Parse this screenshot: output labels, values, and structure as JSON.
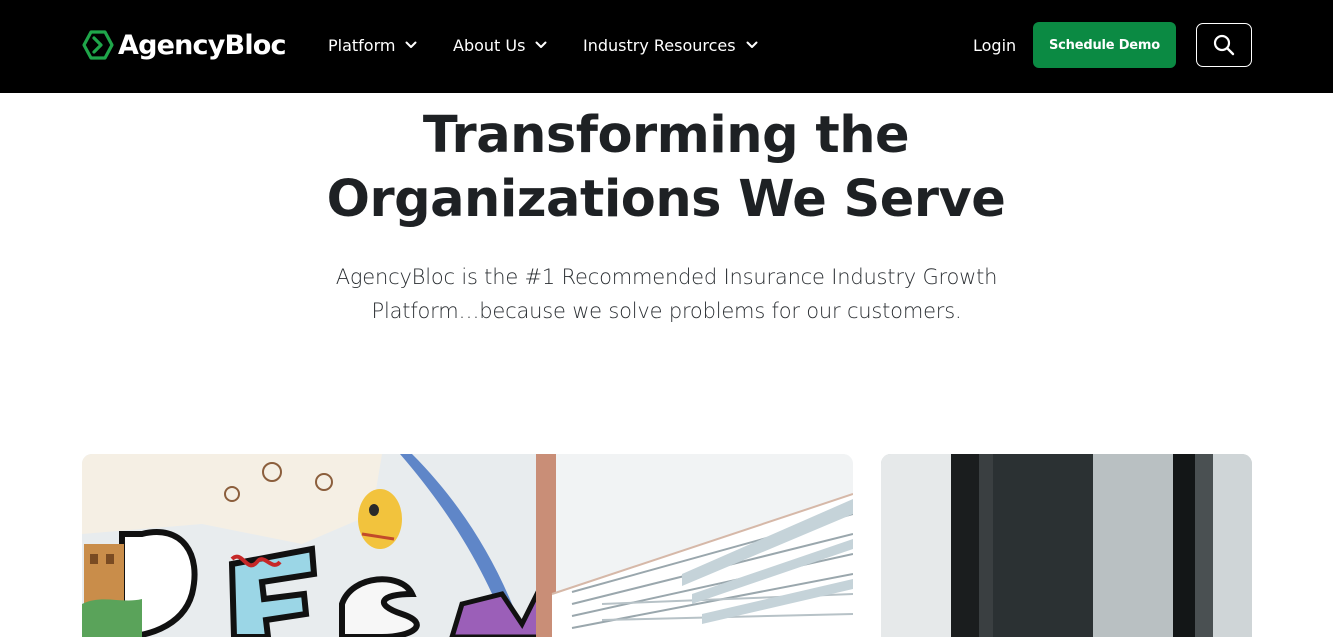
{
  "brand": {
    "name": "AgencyBloc",
    "logo_icon": "hexagon-chevron-logo",
    "logo_color": "#1fa64a"
  },
  "nav": {
    "items": [
      {
        "label": "Platform",
        "icon": "chevron-down-icon"
      },
      {
        "label": "About Us",
        "icon": "chevron-down-icon"
      },
      {
        "label": "Industry Resources",
        "icon": "chevron-down-icon"
      }
    ],
    "login_label": "Login",
    "demo_label": "Schedule Demo",
    "search_icon": "search-icon"
  },
  "hero": {
    "title_line1": "Transforming the",
    "title_line2": "Organizations We Serve",
    "subtitle_line1": "AgencyBloc is the #1 Recommended Insurance Industry Growth",
    "subtitle_line2": "Platform…because we solve problems for our customers."
  },
  "theme": {
    "header_bg": "#000000",
    "accent_green": "#0b8a43",
    "text_dark": "#1e2124"
  },
  "images": {
    "left": "city-mural-photo",
    "right": "office-window-photo"
  }
}
